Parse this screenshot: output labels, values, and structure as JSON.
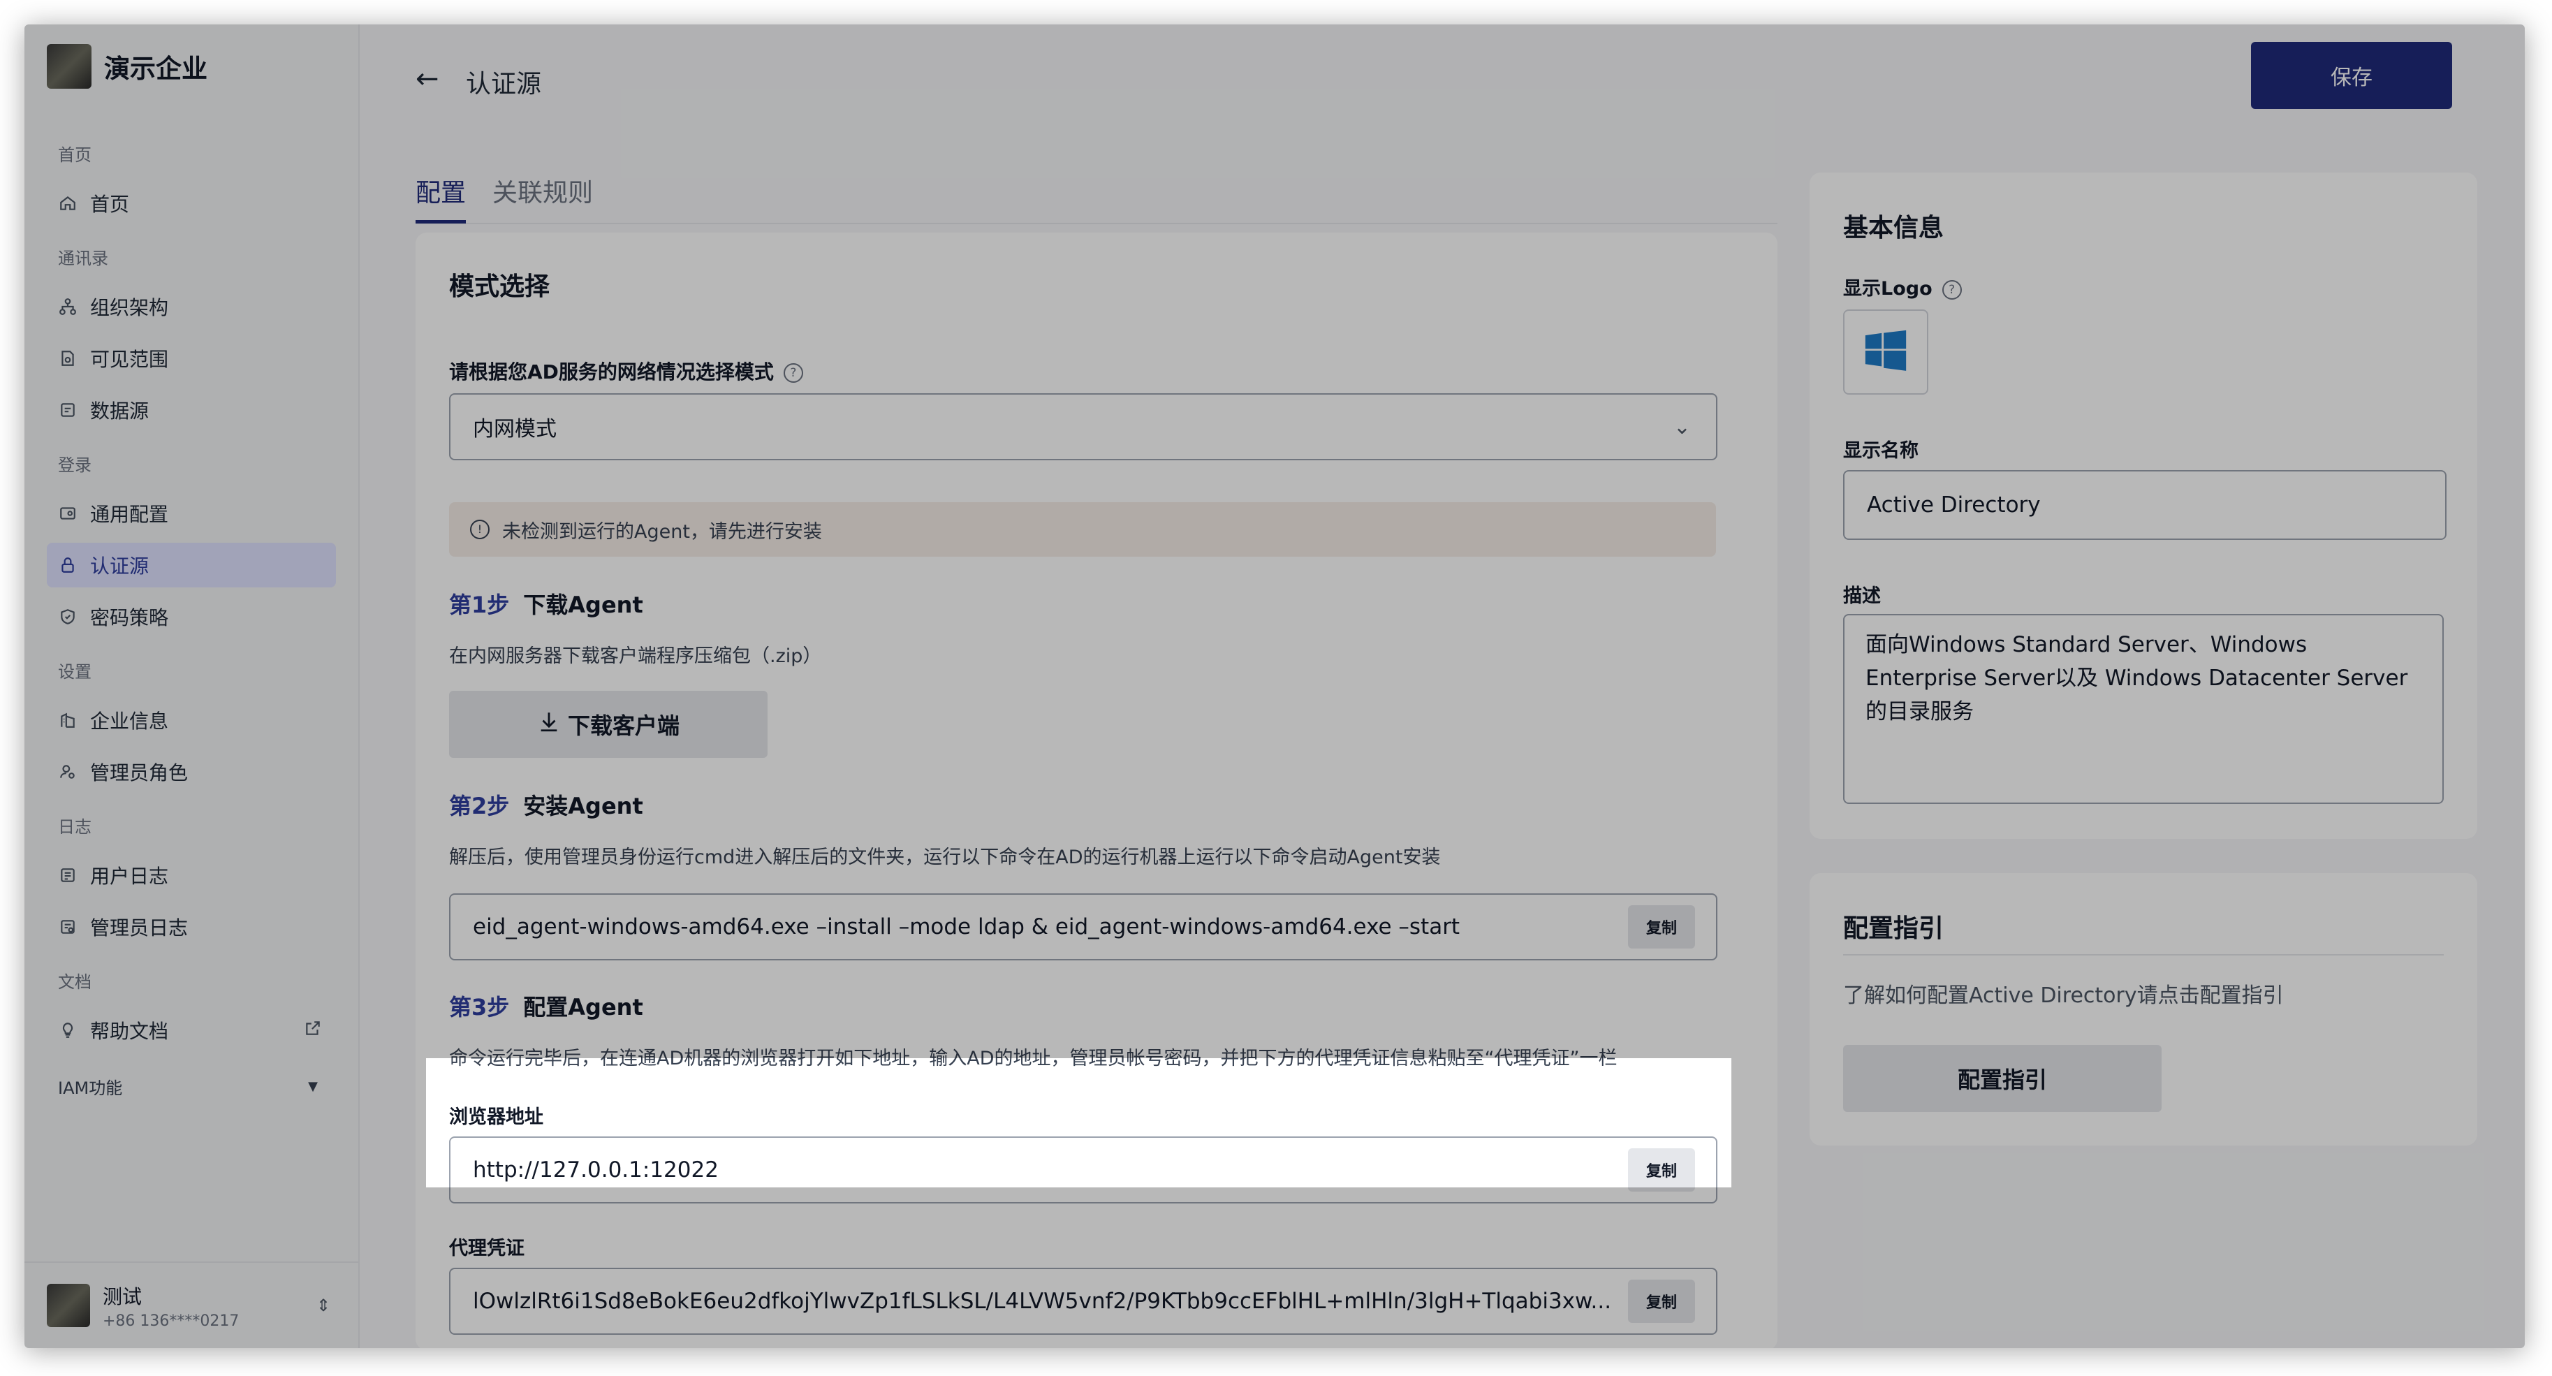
{
  "brand": {
    "name": "演示企业"
  },
  "sidebar": {
    "groups": [
      {
        "title": "首页",
        "items": [
          {
            "label": "首页",
            "icon": "home-icon"
          }
        ]
      },
      {
        "title": "通讯录",
        "items": [
          {
            "label": "组织架构",
            "icon": "org-icon"
          },
          {
            "label": "可见范围",
            "icon": "visibility-icon"
          },
          {
            "label": "数据源",
            "icon": "datasource-icon"
          }
        ]
      },
      {
        "title": "登录",
        "items": [
          {
            "label": "通用配置",
            "icon": "config-icon"
          },
          {
            "label": "认证源",
            "icon": "lock-icon"
          },
          {
            "label": "密码策略",
            "icon": "shield-icon"
          }
        ]
      },
      {
        "title": "设置",
        "items": [
          {
            "label": "企业信息",
            "icon": "building-icon"
          },
          {
            "label": "管理员角色",
            "icon": "admin-icon"
          }
        ]
      },
      {
        "title": "日志",
        "items": [
          {
            "label": "用户日志",
            "icon": "log-icon"
          },
          {
            "label": "管理员日志",
            "icon": "admin-log-icon"
          }
        ]
      },
      {
        "title": "文档",
        "items": [
          {
            "label": "帮助文档",
            "icon": "bulb-icon"
          }
        ]
      }
    ],
    "iam": "IAM功能"
  },
  "user": {
    "name": "测试",
    "phone": "+86 136****0217"
  },
  "header": {
    "title": "认证源",
    "save": "保存"
  },
  "tabs": [
    {
      "label": "配置"
    },
    {
      "label": "关联规则"
    }
  ],
  "config": {
    "mode_title": "模式选择",
    "mode_label": "请根据您AD服务的网络情况选择模式",
    "mode_value": "内网模式",
    "alert": "未检测到运行的Agent，请先进行安装",
    "step1": {
      "num": "第1步",
      "title": "下载Agent",
      "desc": "在内网服务器下载客户端程序压缩包（.zip）",
      "button": "下载客户端"
    },
    "step2": {
      "num": "第2步",
      "title": "安装Agent",
      "desc": "解压后，使用管理员身份运行cmd进入解压后的文件夹，运行以下命令在AD的运行机器上运行以下命令启动Agent安装",
      "command": "eid_agent-windows-amd64.exe –install –mode ldap & eid_agent-windows-amd64.exe –start"
    },
    "step3": {
      "num": "第3步",
      "title": "配置Agent",
      "desc": "命令运行完毕后，在连通AD机器的浏览器打开如下地址，输入AD的地址，管理员帐号密码，并把下方的代理凭证信息粘贴至“代理凭证”一栏"
    },
    "browser_label": "浏览器地址",
    "browser_value": "http://127.0.0.1:12022",
    "proxy_label": "代理凭证",
    "proxy_value": "lOwlzlRt6i1Sd8eBokE6eu2dfkojYlwvZp1fLSLkSL/L4LVW5vnf2/P9KTbb9ccEFblHL+mlHln/3lgH+Tlqabi3xw...",
    "copy": "复制"
  },
  "basic": {
    "title": "基本信息",
    "logo_label": "显示Logo",
    "name_label": "显示名称",
    "name_value": "Active Directory",
    "desc_label": "描述",
    "desc_value": "面向Windows Standard Server、Windows Enterprise Server以及 Windows Datacenter Server的目录服务"
  },
  "guide": {
    "title": "配置指引",
    "desc": "了解如何配置Active Directory请点击配置指引",
    "button": "配置指引"
  },
  "colors": {
    "primary": "#1f2a7a",
    "accent": "#2f3e9e",
    "windows_blue": "#1e7ac7"
  }
}
